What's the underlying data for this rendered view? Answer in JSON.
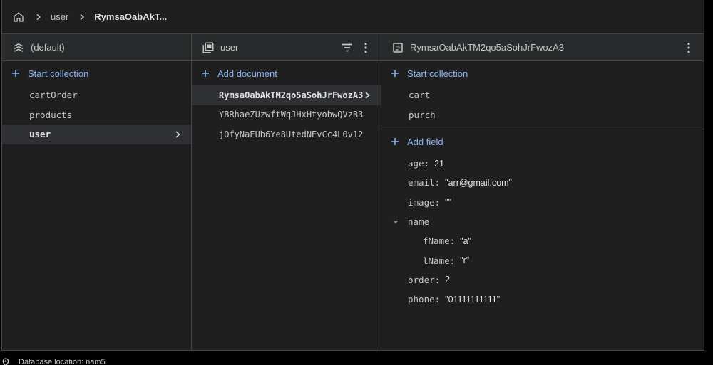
{
  "breadcrumb": {
    "items": [
      "user",
      "RymsaOabAkT..."
    ]
  },
  "columns": {
    "database": {
      "title": "(default)",
      "add_label": "Start collection",
      "items": [
        {
          "label": "cartOrder",
          "selected": false
        },
        {
          "label": "products",
          "selected": false
        },
        {
          "label": "user",
          "selected": true
        }
      ]
    },
    "collection": {
      "title": "user",
      "add_label": "Add document",
      "items": [
        {
          "label": "RymsaOabAkTM2qo5aSohJrFwozA3",
          "selected": true
        },
        {
          "label": "YBRhaeZUzwftWqJHxHtyobwQVzB3",
          "selected": false
        },
        {
          "label": "jOfyNaEUb6Ye8UtedNEvCc4L0v12",
          "selected": false
        }
      ]
    },
    "document": {
      "title": "RymsaOabAkTM2qo5aSohJrFwozA3",
      "add_collection_label": "Start collection",
      "subcollections": [
        "cart",
        "purch"
      ],
      "add_field_label": "Add field",
      "fields": {
        "age": {
          "key": "age:",
          "value": "21"
        },
        "email": {
          "key": "email:",
          "value": "\"arr@gmail.com\""
        },
        "image": {
          "key": "image:",
          "value": "\"\""
        },
        "name": {
          "key": "name"
        },
        "fName": {
          "key": "fName:",
          "value": "\"a\""
        },
        "lName": {
          "key": "lName:",
          "value": "\"r\""
        },
        "order": {
          "key": "order:",
          "value": "2"
        },
        "phone": {
          "key": "phone:",
          "value": "\"01111111111\""
        }
      }
    }
  },
  "footer": {
    "text": "Database location: nam5"
  },
  "icons": {
    "home": "home-icon",
    "database": "database-layers-icon",
    "collection": "collection-icon",
    "document": "document-icon",
    "filter": "filter-icon",
    "more": "more-vert-icon"
  },
  "colors": {
    "accent": "#8ab4f8",
    "background": "#1f1f1f",
    "header": "#282a2c",
    "selected": "#2e3033",
    "border": "#444746"
  }
}
